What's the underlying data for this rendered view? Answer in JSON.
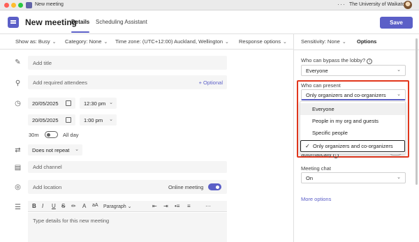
{
  "window": {
    "title": "New meeting",
    "org_name": "The University of Waikato",
    "more_label": "···"
  },
  "header": {
    "title": "New meeting",
    "tabs": [
      {
        "label": "Details",
        "active": true
      },
      {
        "label": "Scheduling Assistant",
        "active": false
      }
    ],
    "save_label": "Save"
  },
  "options_bar": {
    "show_as": "Show as: Busy",
    "category": "Category: None",
    "time_zone": "Time zone: (UTC+12:00) Auckland, Wellington",
    "response_options": "Response options"
  },
  "form": {
    "title_placeholder": "Add title",
    "attendees_placeholder": "Add required attendees",
    "optional_link": "+ Optional",
    "start_date": "20/05/2025",
    "start_time": "12:30 pm",
    "end_date": "20/05/2025",
    "end_time": "1:00 pm",
    "duration": "30m",
    "all_day_label": "All day",
    "all_day_on": false,
    "repeat": "Does not repeat",
    "channel_placeholder": "Add channel",
    "location_placeholder": "Add location",
    "online_meeting_label": "Online meeting",
    "online_meeting_on": true,
    "editor_placeholder": "Type details for this new meeting",
    "editor_toolbar": {
      "bold": "B",
      "italic": "I",
      "underline": "U",
      "strike": "S",
      "paragraph": "Paragraph",
      "more": "···"
    }
  },
  "right_pane": {
    "sensitivity": "Sensitivity: None",
    "options_label": "Options",
    "bypass_lobby_label": "Who can bypass the lobby?",
    "bypass_lobby_value": "Everyone",
    "present_label": "Who can present",
    "present_value": "Only organizers and co-organizers",
    "present_options": [
      "Everyone",
      "People in my org and guests",
      "Specific people",
      "Only organizers and co-organizers"
    ],
    "present_selected_index": 3,
    "automatically_text": "automatically",
    "meeting_chat_label": "Meeting chat",
    "meeting_chat_value": "On",
    "more_options": "More options"
  },
  "colors": {
    "accent": "#5b5fc7",
    "highlight": "#e2371d"
  }
}
